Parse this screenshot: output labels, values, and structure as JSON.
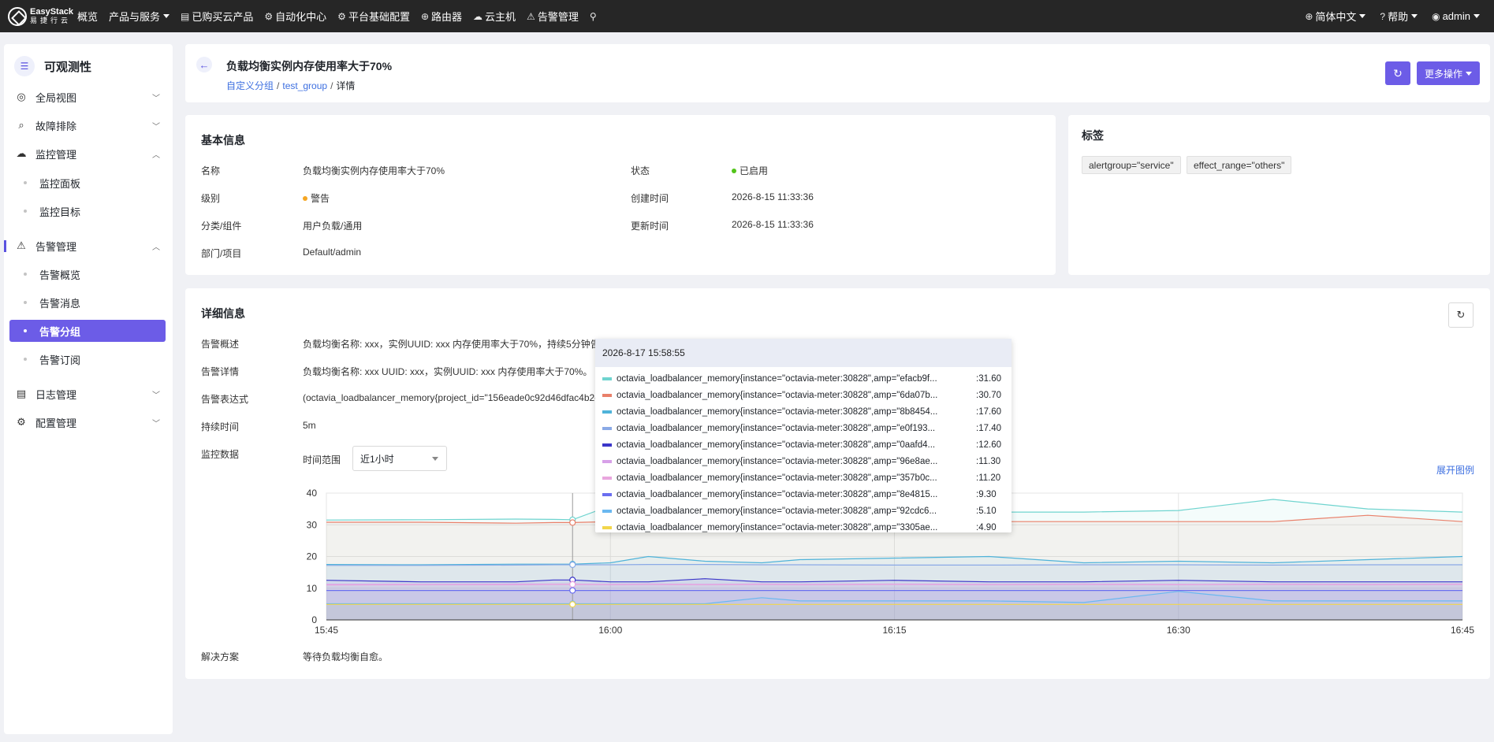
{
  "topbar": {
    "logo_brand": "EasyStack",
    "logo_sub": "易捷行云",
    "nav": [
      {
        "icon": "home-icon",
        "glyph": "",
        "label": "概览",
        "dropdown": false
      },
      {
        "icon": "grid-icon",
        "glyph": "",
        "label": "产品与服务",
        "dropdown": true
      },
      {
        "icon": "purchased-icon",
        "glyph": "▤",
        "label": "已购买云产品",
        "dropdown": false
      },
      {
        "icon": "automation-icon",
        "glyph": "⚙",
        "label": "自动化中心",
        "dropdown": false
      },
      {
        "icon": "platform-config-icon",
        "glyph": "⚙",
        "label": "平台基础配置",
        "dropdown": false
      },
      {
        "icon": "router-icon",
        "glyph": "⊕",
        "label": "路由器",
        "dropdown": false
      },
      {
        "icon": "cloud-host-icon",
        "glyph": "☁",
        "label": "云主机",
        "dropdown": false
      },
      {
        "icon": "alarm-icon",
        "glyph": "⚠",
        "label": "告警管理",
        "dropdown": false
      },
      {
        "icon": "pin-icon",
        "glyph": "⚲",
        "label": "",
        "dropdown": false
      }
    ],
    "right": [
      {
        "icon": "globe-icon",
        "glyph": "⊕",
        "label": "简体中文"
      },
      {
        "icon": "help-icon",
        "glyph": "?",
        "label": "帮助"
      },
      {
        "icon": "user-icon",
        "glyph": "◉",
        "label": "admin"
      }
    ]
  },
  "sidebar": {
    "title": "可观测性",
    "items": [
      {
        "label": "全局视图",
        "icon": "global-view-icon",
        "glyph": "◎",
        "chevron": "﹀"
      },
      {
        "label": "故障排除",
        "icon": "troubleshoot-icon",
        "glyph": "⌕",
        "chevron": "﹀"
      },
      {
        "label": "监控管理",
        "icon": "monitor-icon",
        "glyph": "☁",
        "chevron": "︿"
      },
      {
        "label": "告警管理",
        "icon": "alarm-icon",
        "glyph": "⚠",
        "chevron": "︿"
      },
      {
        "label": "日志管理",
        "icon": "log-icon",
        "glyph": "▤",
        "chevron": "﹀"
      },
      {
        "label": "配置管理",
        "icon": "config-icon",
        "glyph": "⚙",
        "chevron": "﹀"
      }
    ],
    "monitor_sub": [
      "监控面板",
      "监控目标"
    ],
    "alarm_sub": [
      "告警概览",
      "告警消息",
      "告警分组",
      "告警订阅"
    ]
  },
  "header": {
    "title": "负载均衡实例内存使用率大于70%",
    "breadcrumb": [
      "自定义分组",
      "test_group",
      "详情"
    ],
    "more_label": "更多操作"
  },
  "basic": {
    "title": "基本信息",
    "name_label": "名称",
    "name": "负载均衡实例内存使用率大于70%",
    "level_label": "级别",
    "level": "警告",
    "level_color": "#f5a623",
    "category_label": "分类/组件",
    "category": "用户负载/通用",
    "dept_label": "部门/项目",
    "dept": "Default/admin",
    "status_label": "状态",
    "status": "已启用",
    "status_color": "#52c41a",
    "created_label": "创建时间",
    "created": "2026-8-15 11:33:36",
    "updated_label": "更新时间",
    "updated": "2026-8-15 11:33:36"
  },
  "tags": {
    "title": "标签",
    "items": [
      "alertgroup=\"service\"",
      "effect_range=\"others\""
    ]
  },
  "detail": {
    "title": "详细信息",
    "summary_label": "告警概述",
    "summary": "负载均衡名称: xxx，实例UUID: xxx 内存使用率大于70%，持续5分钟告警",
    "detail_label": "告警详情",
    "detail_text": "负载均衡名称: xxx UUID: xxx，实例UUID: xxx 内存使用率大于70%。",
    "expr_label": "告警表达式",
    "expr": "(octavia_loadbalancer_memory{project_id=\"156eade0c92d46dfac4b2e",
    "duration_label": "持续时间",
    "duration": "5m",
    "monitor_label": "监控数据",
    "time_range_label": "时间范围",
    "time_range": "近1小时",
    "expand_legend": "展开图例",
    "solution_label": "解决方案",
    "solution": "等待负载均衡自愈。"
  },
  "tooltip": {
    "time": "2026-8-17 15:58:55",
    "rows": [
      {
        "name": "octavia_loadbalancer_memory{instance=\"octavia-meter:30828\",amp=\"efacb9f...",
        "value": "31.60",
        "color": "#6fd4cf"
      },
      {
        "name": "octavia_loadbalancer_memory{instance=\"octavia-meter:30828\",amp=\"6da07b...",
        "value": "30.70",
        "color": "#e9806a"
      },
      {
        "name": "octavia_loadbalancer_memory{instance=\"octavia-meter:30828\",amp=\"8b8454...",
        "value": "17.60",
        "color": "#4fb3d9"
      },
      {
        "name": "octavia_loadbalancer_memory{instance=\"octavia-meter:30828\",amp=\"e0f193...",
        "value": "17.40",
        "color": "#8aa9e6"
      },
      {
        "name": "octavia_loadbalancer_memory{instance=\"octavia-meter:30828\",amp=\"0aafd4...",
        "value": "12.60",
        "color": "#3b36c9"
      },
      {
        "name": "octavia_loadbalancer_memory{instance=\"octavia-meter:30828\",amp=\"96e8ae...",
        "value": "11.30",
        "color": "#d7a0e8"
      },
      {
        "name": "octavia_loadbalancer_memory{instance=\"octavia-meter:30828\",amp=\"357b0c...",
        "value": "11.20",
        "color": "#e9a6de"
      },
      {
        "name": "octavia_loadbalancer_memory{instance=\"octavia-meter:30828\",amp=\"8e4815...",
        "value": "9.30",
        "color": "#6a6ef0"
      },
      {
        "name": "octavia_loadbalancer_memory{instance=\"octavia-meter:30828\",amp=\"92cdc6...",
        "value": "5.10",
        "color": "#6ab8f0"
      },
      {
        "name": "octavia_loadbalancer_memory{instance=\"octavia-meter:30828\",amp=\"3305ae...",
        "value": "4.90",
        "color": "#f2d64b"
      }
    ]
  },
  "chart_data": {
    "type": "area",
    "xlabels": [
      "15:45",
      "16:00",
      "16:15",
      "16:30",
      "16:45"
    ],
    "yticks": [
      0,
      10,
      20,
      30,
      40
    ],
    "ylim": [
      0,
      40
    ],
    "grid": true,
    "cursor_time": "15:58:55",
    "x_minutes": [
      0,
      5,
      10,
      12,
      13,
      15,
      17,
      20,
      23,
      25,
      30,
      35,
      40,
      45,
      50,
      55,
      60
    ],
    "series": [
      {
        "color": "#6fd4cf",
        "values": [
          31.5,
          31.6,
          31.8,
          31.7,
          31.6,
          36,
          36,
          36,
          35.5,
          36,
          35,
          34,
          34,
          34.5,
          38,
          35,
          34
        ]
      },
      {
        "color": "#e9806a",
        "values": [
          30.8,
          30.8,
          30.5,
          30.7,
          30.7,
          31,
          31,
          31.5,
          32,
          32,
          31.5,
          31,
          31,
          31,
          31,
          33,
          31
        ]
      },
      {
        "color": "#4fb3d9",
        "values": [
          17.5,
          17.4,
          17.6,
          17.6,
          17.6,
          18,
          20,
          18.5,
          18,
          19,
          19.5,
          20,
          18,
          18.5,
          18,
          19,
          20
        ]
      },
      {
        "color": "#8aa9e6",
        "values": [
          17.2,
          17.2,
          17.3,
          17.4,
          17.4,
          17.4,
          17.5,
          17.5,
          17.4,
          17.4,
          17.3,
          17.3,
          17.4,
          17.4,
          17.3,
          17.4,
          17.4
        ]
      },
      {
        "color": "#3b36c9",
        "values": [
          12.5,
          12,
          12,
          12.6,
          12.6,
          12,
          12,
          13,
          12,
          12,
          12.5,
          12,
          12,
          12.5,
          12,
          12,
          12
        ]
      },
      {
        "color": "#d7a0e8",
        "values": [
          11.2,
          11.2,
          11.3,
          11.3,
          11.3,
          11.2,
          11.3,
          11.2,
          11.3,
          11.2,
          11.3,
          11.2,
          11.3,
          11.2,
          11.3,
          11.2,
          11.3
        ]
      },
      {
        "color": "#e9a6de",
        "values": [
          11,
          11.1,
          11.1,
          11.2,
          11.2,
          11.1,
          11.2,
          11.1,
          11.2,
          11.1,
          11.2,
          11.1,
          11.2,
          11.1,
          11.2,
          11.1,
          11.2
        ]
      },
      {
        "color": "#6a6ef0",
        "values": [
          9.3,
          9.3,
          9.3,
          9.3,
          9.3,
          9.3,
          9.3,
          9.3,
          9.3,
          9.3,
          9.3,
          9.3,
          9.3,
          9.3,
          9.3,
          9.3,
          9.3
        ]
      },
      {
        "color": "#6ab8f0",
        "values": [
          5.1,
          5.1,
          5.1,
          5.1,
          5.1,
          5.1,
          5.1,
          5.1,
          7,
          6,
          6,
          6,
          5.5,
          9,
          6,
          6,
          6
        ]
      },
      {
        "color": "#f2d64b",
        "values": [
          4.9,
          4.9,
          4.9,
          4.9,
          4.9,
          4.9,
          4.9,
          4.9,
          4.9,
          4.9,
          4.9,
          4.9,
          4.9,
          4.9,
          4.9,
          4.9,
          4.9
        ]
      }
    ]
  }
}
